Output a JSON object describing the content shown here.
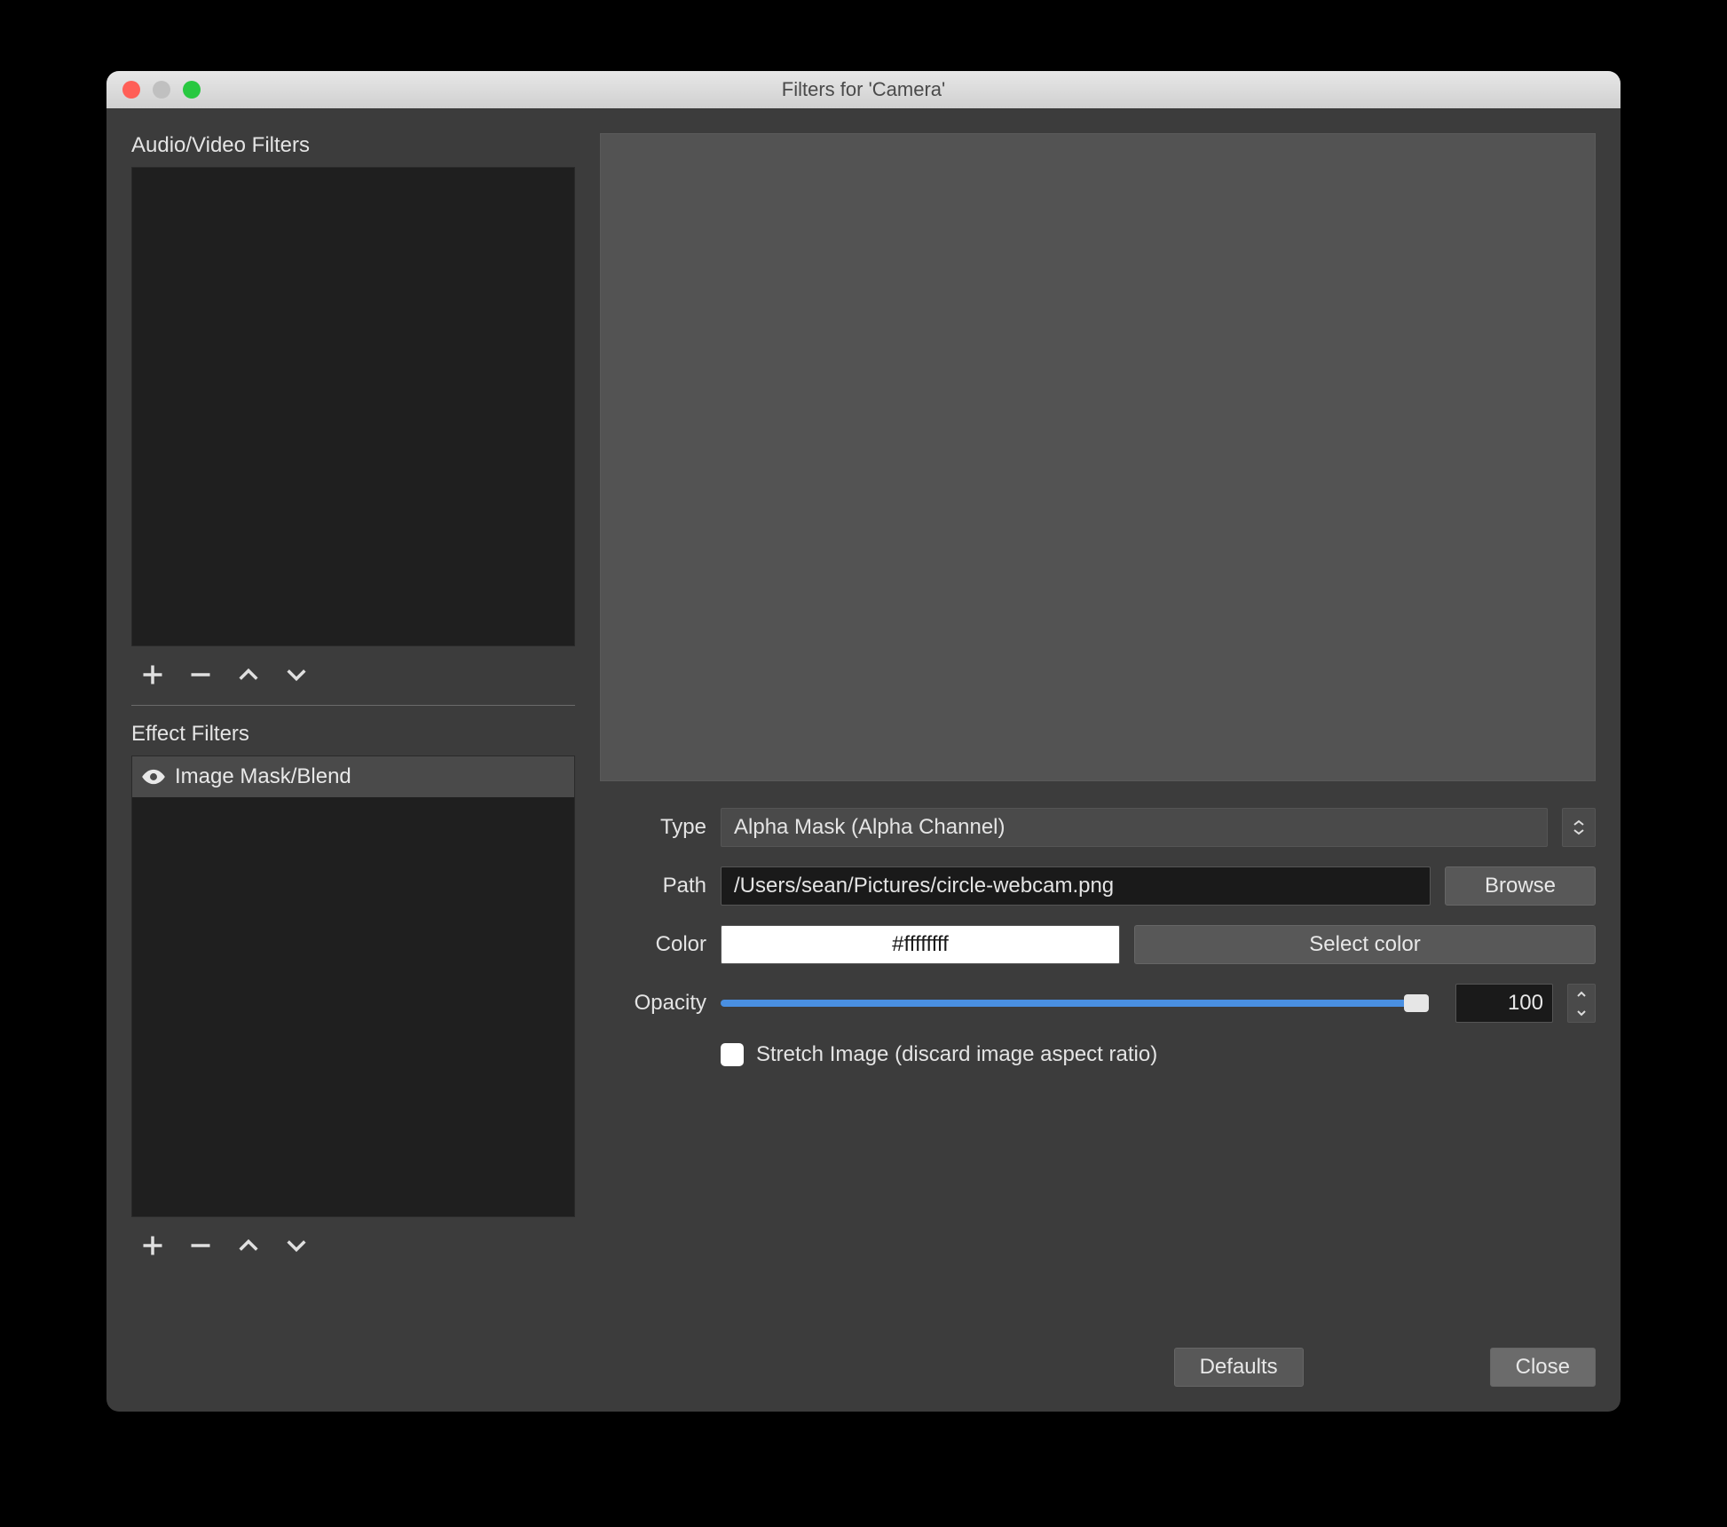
{
  "window": {
    "title": "Filters for 'Camera'"
  },
  "left": {
    "av_filters_label": "Audio/Video Filters",
    "effect_filters_label": "Effect Filters",
    "effect_items": [
      {
        "label": "Image Mask/Blend"
      }
    ]
  },
  "form": {
    "type_label": "Type",
    "type_value": "Alpha Mask (Alpha Channel)",
    "path_label": "Path",
    "path_value": "/Users/sean/Pictures/circle-webcam.png",
    "browse_label": "Browse",
    "color_label": "Color",
    "color_value": "#ffffffff",
    "color_swatch_hex": "#ffffff",
    "select_color_label": "Select color",
    "opacity_label": "Opacity",
    "opacity_value": "100",
    "stretch_label": "Stretch Image (discard image aspect ratio)",
    "stretch_checked": false
  },
  "buttons": {
    "defaults": "Defaults",
    "close": "Close"
  }
}
